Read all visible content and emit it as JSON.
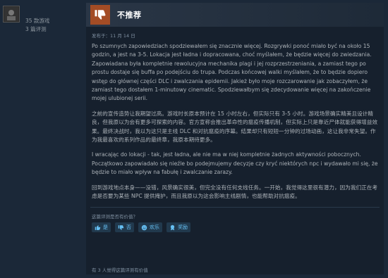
{
  "user": {
    "games_owned": "35 款游戏",
    "reviews_count": "3 篇评测"
  },
  "review": {
    "verdict": "不推荐",
    "posted_date": "发布于：11 月 14 日",
    "paragraphs": [
      "Po szumnych zapowiedziach spodziewałem się znacznie więcej. Rozgrywki ponoć miało być na około 15 godzin, a jest na 3-5. Lokacja jest ładna i dopracowana, choć myślałem, że będzie więcej do zwiedzania. Zapowiadana była kompletnie rewolucyjna mechanika plagi i jej rozprzestrzeniania, a zamiast tego po prostu dostaje się buffa po podejściu do trupa. Podczas końcowej walki myślałem, że to będzie dopiero wstęp do głównej części DLC i zwalczania epidemii. Jakież było moje rozczarowanie jak zobaczyłem, że zamiast tego dostałem 1-minutowy cinematic. Spodziewałbym się zdecydowanie więcej na zakończenie mojej ulubionej serii.",
      "之前的宣传造势让我期望过高。游戏时长原本预计在 15 小时左右，但实际只有 3-5 小时。游戏场景确实精美且设计精良，但我原以为会有更多可探索的内容。官方宣称会推出革命性的瘟疫传播机制，但实际上只是靠近尸体就能获得增益效果。最终决战时，我以为这只是主线 DLC 和对抗瘟疫的序幕。结果却只有短短一分钟的过场动画，这让我非常失望。作为我最喜欢的系列作品的最终章，我原本期待更多。",
      "I wracając do lokacji - tak, jest ładna, ale nie ma w niej kompletnie żadnych aktywności pobocznych. Początkowo zapowiadało się nieźle bo podejmujemy decyzje czy kryć niektórych npc i wydawało mi się, że będzie to miało wpływ na fabułę i zwalczanie zarazy.",
      "回到游戏地点本身——没错，风景确实很美，但完全没有任何支线任务。一开始，我觉得这里很有潜力，因为我们正在考虑是否要为某些 NPC 提供掩护，而且我原以为这会影响主线剧情，也能帮助对抗瘟疫。"
    ],
    "helpful_question": "这篇评测是否有价值？",
    "buttons": {
      "yes": "是",
      "no": "否",
      "funny": "欢乐",
      "award": "奖励"
    },
    "helpful_count": "有 3 人觉得这篇评测有价值"
  },
  "colors": {
    "background": "#1b2838",
    "thumb_down_bg": "#a34c25",
    "link_blue": "#66c0f4"
  },
  "icons": {
    "avatar": "avatar-image",
    "verdict": "thumbs-down-icon",
    "yes": "thumbs-up-icon",
    "no": "thumbs-down-icon",
    "funny": "smiley-icon",
    "award": "award-icon"
  }
}
